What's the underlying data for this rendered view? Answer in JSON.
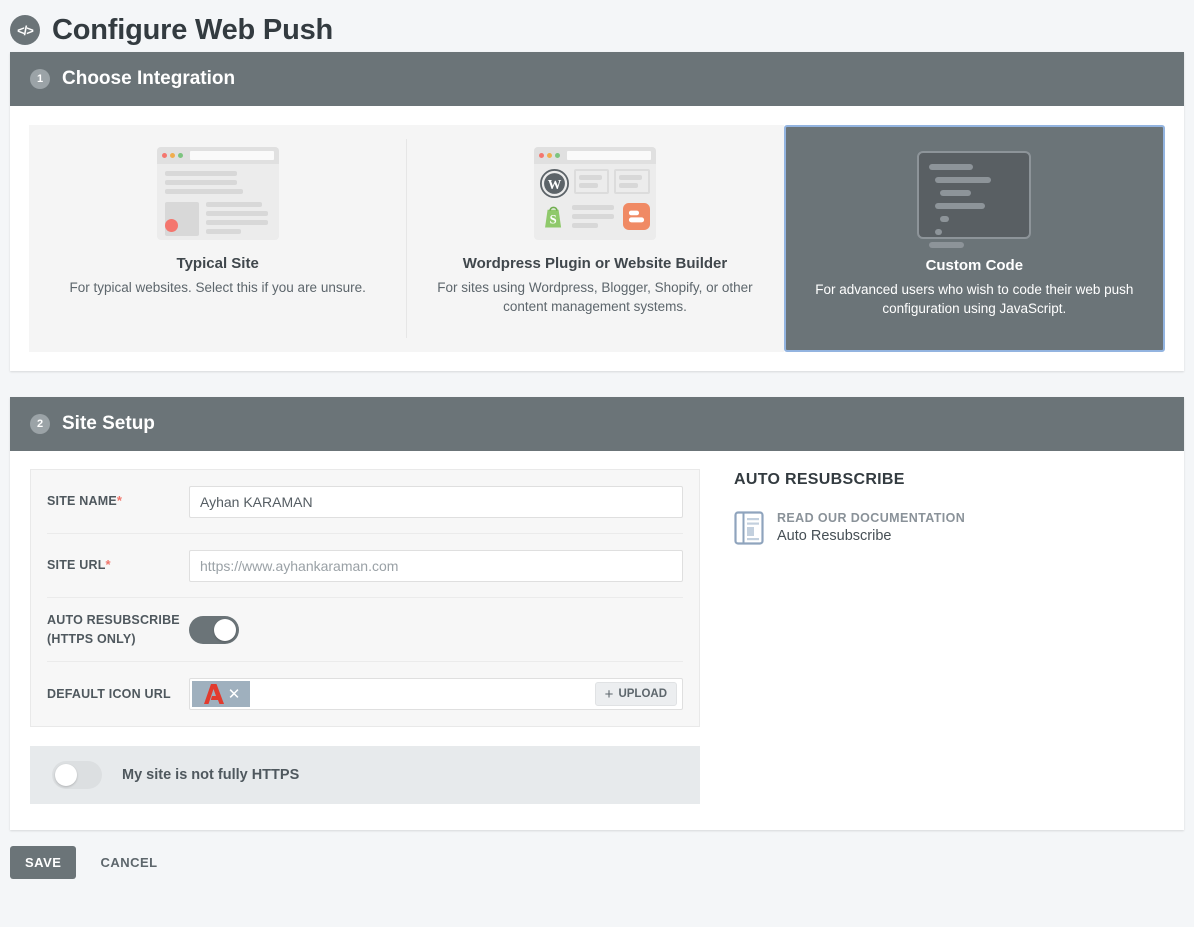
{
  "header": {
    "icon": "code-icon",
    "title": "Configure Web Push"
  },
  "sections": {
    "integration": {
      "step": "1",
      "title": "Choose Integration",
      "cards": [
        {
          "id": "typical-site",
          "icon": "browser-window-icon",
          "title": "Typical Site",
          "desc": "For typical websites. Select this if you are unsure.",
          "selected": false
        },
        {
          "id": "wordpress-plugin",
          "icon": "cms-browser-icon",
          "title": "Wordpress Plugin or Website Builder",
          "desc": "For sites using Wordpress, Blogger, Shopify, or other content management systems.",
          "selected": false
        },
        {
          "id": "custom-code",
          "icon": "code-window-icon",
          "title": "Custom Code",
          "desc": "For advanced users who wish to code their web push configuration using JavaScript.",
          "selected": true
        }
      ]
    },
    "site_setup": {
      "step": "2",
      "title": "Site Setup",
      "fields": {
        "site_name": {
          "label": "SITE NAME",
          "required": "*",
          "value": "Ayhan KARAMAN",
          "placeholder": ""
        },
        "site_url": {
          "label": "SITE URL",
          "required": "*",
          "value": "",
          "placeholder": "https://www.ayhankaraman.com"
        },
        "auto_resubscribe": {
          "label": "AUTO RESUBSCRIBE (HTTPS ONLY)",
          "label_line1": "AUTO RESUBSCRIBE",
          "label_line2": "(HTTPS ONLY)",
          "state": "on"
        },
        "default_icon_url": {
          "label": "DEFAULT ICON URL",
          "value": "",
          "thumbnail": "site-logo-thumbnail",
          "remove_label": "✕",
          "upload_label": "UPLOAD",
          "upload_plus": "+"
        },
        "not_https": {
          "label": "My site is not fully HTTPS",
          "state": "off"
        }
      },
      "sidebar": {
        "title": "AUTO RESUBSCRIBE",
        "doc": {
          "icon": "document-icon",
          "kicker": "READ OUR DOCUMENTATION",
          "name": "Auto Resubscribe"
        }
      }
    }
  },
  "footer": {
    "save_label": "SAVE",
    "cancel_label": "CANCEL"
  },
  "colors": {
    "page_bg": "#f4f6f8",
    "header_bar": "#6b7478",
    "selected_card": "#6b7478",
    "selection_border": "#93b4e0",
    "required_star": "#f0756a",
    "accent_red": "#e23b2e"
  }
}
